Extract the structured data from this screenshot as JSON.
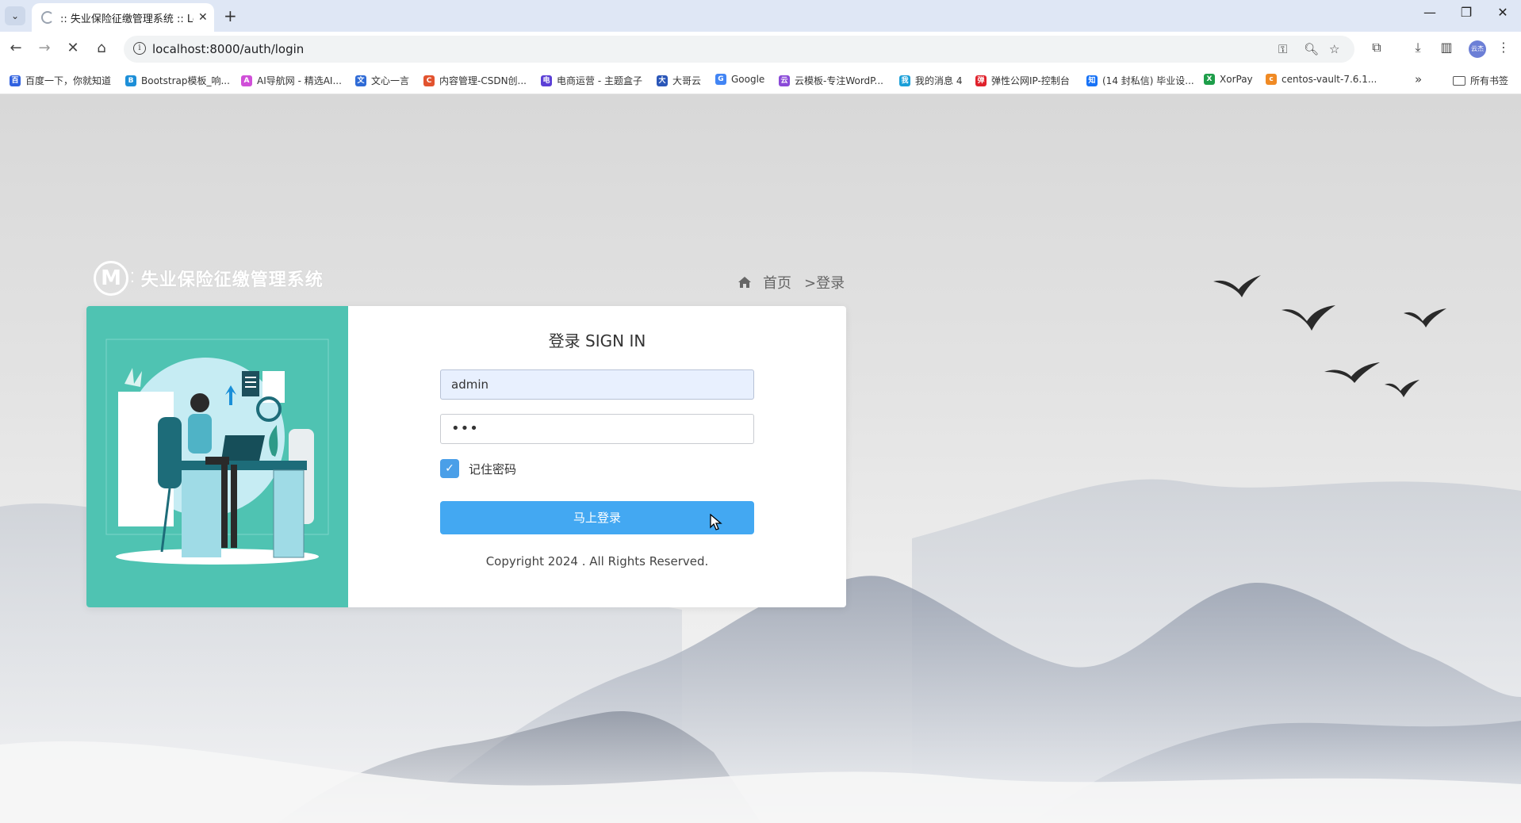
{
  "browser": {
    "tab_title": ":: 失业保险征缴管理系统 :: Log",
    "url": "localhost:8000/auth/login",
    "profile_label": "云杰",
    "bookmarks": [
      {
        "label": "百度一下，你就知道",
        "color": "#3162e0",
        "glyph": "百"
      },
      {
        "label": "Bootstrap模板_响...",
        "color": "#1d8fd8",
        "glyph": "B"
      },
      {
        "label": "AI导航网 - 精选AI...",
        "color": "#d04fd8",
        "glyph": "A"
      },
      {
        "label": "文心一言",
        "color": "#2f6bd6",
        "glyph": "文"
      },
      {
        "label": "内容管理-CSDN创...",
        "color": "#e2532f",
        "glyph": "C"
      },
      {
        "label": "电商运营 - 主题盒子",
        "color": "#5b3fd6",
        "glyph": "电"
      },
      {
        "label": "大哥云",
        "color": "#2a56b8",
        "glyph": "大"
      },
      {
        "label": "Google",
        "color": "#4285f4",
        "glyph": "G"
      },
      {
        "label": "云模板-专注WordP...",
        "color": "#8a4ad8",
        "glyph": "云"
      },
      {
        "label": "我的消息 4",
        "color": "#1a9fd8",
        "glyph": "我"
      },
      {
        "label": "弹性公网IP-控制台",
        "color": "#e0212b",
        "glyph": "弹"
      },
      {
        "label": "(14 封私信) 毕业设...",
        "color": "#1772f6",
        "glyph": "知"
      },
      {
        "label": "XorPay",
        "color": "#1e9e4a",
        "glyph": "X"
      },
      {
        "label": "centos-vault-7.6.1...",
        "color": "#f08a24",
        "glyph": "c"
      }
    ],
    "all_bookmarks": "所有书签"
  },
  "page": {
    "brand_name": "失业保险征缴管理系统",
    "breadcrumb": {
      "home": "首页",
      "current": ">登录"
    },
    "login": {
      "title": "登录 SIGN IN",
      "username": "admin",
      "password_mask": "•••",
      "remember_label": "记住密码",
      "remember_checked": true,
      "submit_label": "马上登录",
      "copyright": "Copyright 2024 . All Rights Reserved."
    }
  },
  "colors": {
    "panel_teal": "#4fc3b2",
    "button_blue": "#43a8f2",
    "checkbox_blue": "#4a9fe8"
  }
}
